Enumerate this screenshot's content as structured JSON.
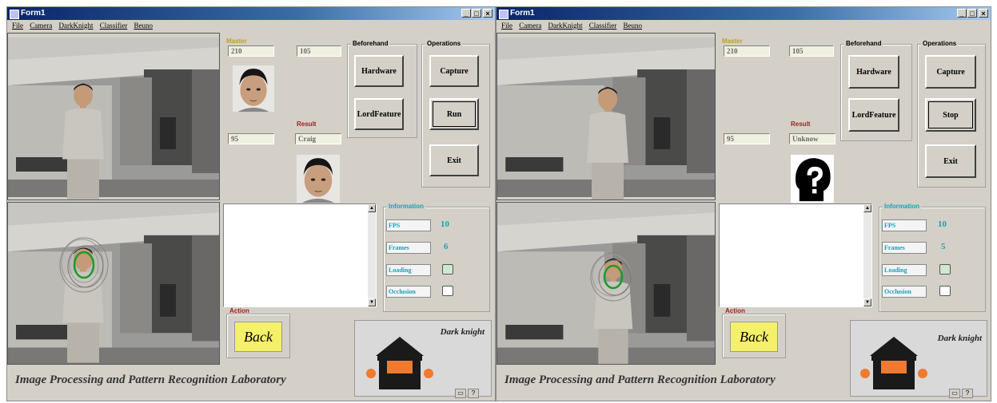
{
  "windows": [
    {
      "title": "Form1",
      "menu": [
        "File",
        "Camera",
        "DarkKnight",
        "Classifier",
        "Beuno"
      ],
      "master": {
        "title": "Master",
        "val1": "210",
        "val2": "105",
        "val3": "95"
      },
      "beforehand": {
        "title": "Beforehand",
        "hardware": "Hardware",
        "loadfeature": "LordFeature"
      },
      "operations": {
        "title": "Operations",
        "capture": "Capture",
        "run": "Run",
        "exit": "Exit"
      },
      "result": {
        "title": "Result",
        "value": "Craig",
        "image": "face"
      },
      "information": {
        "title": "Information",
        "fps_label": "FPS",
        "fps_value": "10",
        "frames_label": "Frames",
        "frames_value": "6",
        "loading_label": "Loading",
        "occlusion_label": "Occlusion",
        "loading_checked": true,
        "occlusion_checked": false
      },
      "action": {
        "title": "Action",
        "back": "Back"
      },
      "robot_label": "Dark knight",
      "footer": "Image Processing and Pattern Recognition Laboratory"
    },
    {
      "title": "Form1",
      "menu": [
        "File",
        "Camera",
        "DarkKnight",
        "Classifier",
        "Beuno"
      ],
      "master": {
        "title": "Master",
        "val1": "210",
        "val2": "105",
        "val3": "95"
      },
      "beforehand": {
        "title": "Beforehand",
        "hardware": "Hardware",
        "loadfeature": "LordFeature"
      },
      "operations": {
        "title": "Operations",
        "capture": "Capture",
        "run": "Stop",
        "exit": "Exit"
      },
      "result": {
        "title": "Result",
        "value": "Unknow",
        "image": "question"
      },
      "information": {
        "title": "Information",
        "fps_label": "FPS",
        "fps_value": "10",
        "frames_label": "Frames",
        "frames_value": "5",
        "loading_label": "Loading",
        "occlusion_label": "Occlusion",
        "loading_checked": true,
        "occlusion_checked": false
      },
      "action": {
        "title": "Action",
        "back": "Back"
      },
      "robot_label": "Dark knight",
      "footer": "Image Processing and Pattern Recognition Laboratory"
    }
  ],
  "title_buttons": {
    "minimize": "_",
    "maximize": "□",
    "close": "×"
  },
  "colors": {
    "title_blue": "#0a246a",
    "info_cyan": "#1aa0b8",
    "back_yellow": "#f5f06a",
    "robot_orange": "#f07a30",
    "group_title_red": "#a02020",
    "master_title": "#c0a020"
  }
}
